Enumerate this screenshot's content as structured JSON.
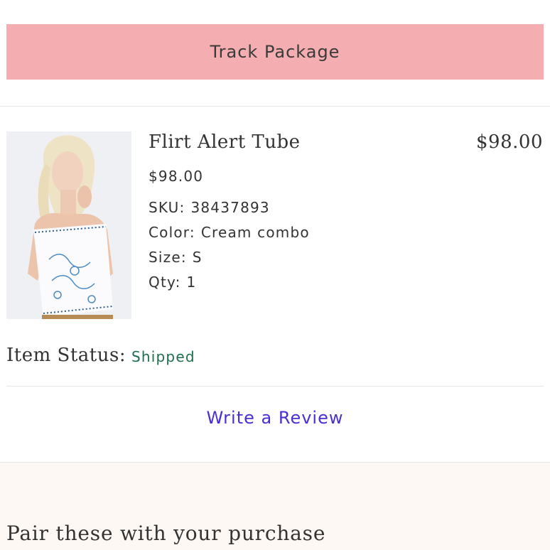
{
  "track_package": {
    "label": "Track Package"
  },
  "item": {
    "name": "Flirt Alert Tube",
    "line_total": "$98.00",
    "price": "$98.00",
    "sku_label": "SKU:",
    "sku": "38437893",
    "color_label": "Color:",
    "color": "Cream combo",
    "size_label": "Size:",
    "size": "S",
    "qty_label": "Qty:",
    "qty": "1"
  },
  "status": {
    "label": "Item Status:",
    "value": "Shipped",
    "value_color": "#1e6e4e"
  },
  "review": {
    "label": "Write a Review",
    "link_color": "#4b2fd6"
  },
  "recommendations": {
    "title": "Pair these with your purchase"
  },
  "colors": {
    "track_button_bg": "#f4aeb1",
    "recs_bg": "#fdf8f3"
  }
}
